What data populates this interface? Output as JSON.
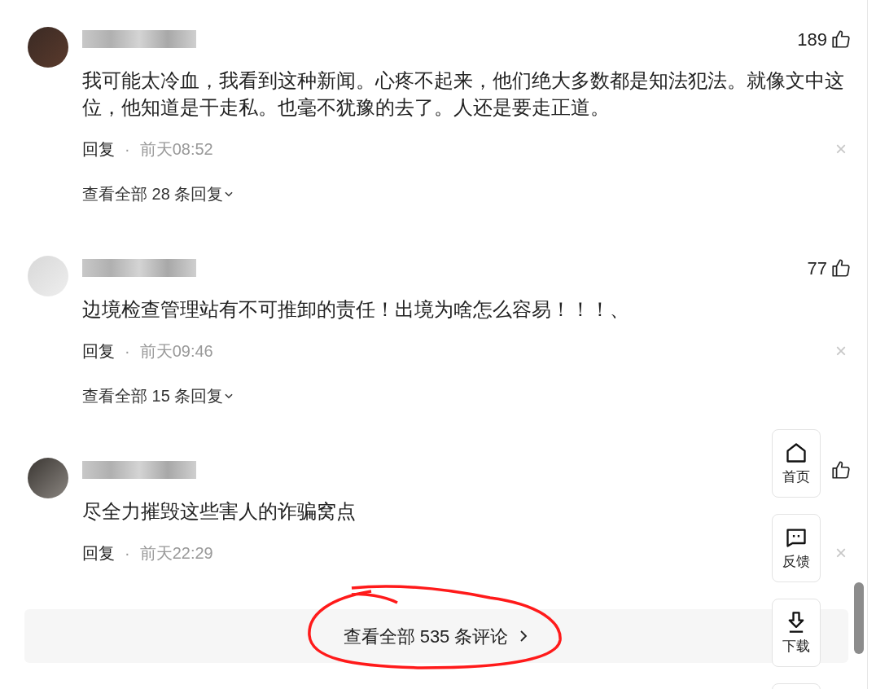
{
  "comments": [
    {
      "likes": "189",
      "text": "我可能太冷血，我看到这种新闻。心疼不起来，他们绝大多数都是知法犯法。就像文中这位，他知道是干走私。也毫不犹豫的去了。人还是要走正道。",
      "reply_label": "回复",
      "separator": "·",
      "time": "前天08:52",
      "close": "×",
      "replies_link": "查看全部 28 条回复"
    },
    {
      "likes": "77",
      "text": "边境检查管理站有不可推卸的责任！出境为啥怎么容易！！！、",
      "reply_label": "回复",
      "separator": "·",
      "time": "前天09:46",
      "close": "×",
      "replies_link": "查看全部 15 条回复"
    },
    {
      "text": "尽全力摧毁这些害人的诈骗窝点",
      "reply_label": "回复",
      "separator": "·",
      "time": "前天22:29",
      "close": "×"
    }
  ],
  "view_all": "查看全部 535 条评论",
  "side_buttons": [
    {
      "kind": "home",
      "label": "首页"
    },
    {
      "kind": "feedback",
      "label": "反馈"
    },
    {
      "kind": "download",
      "label": "下载"
    }
  ]
}
